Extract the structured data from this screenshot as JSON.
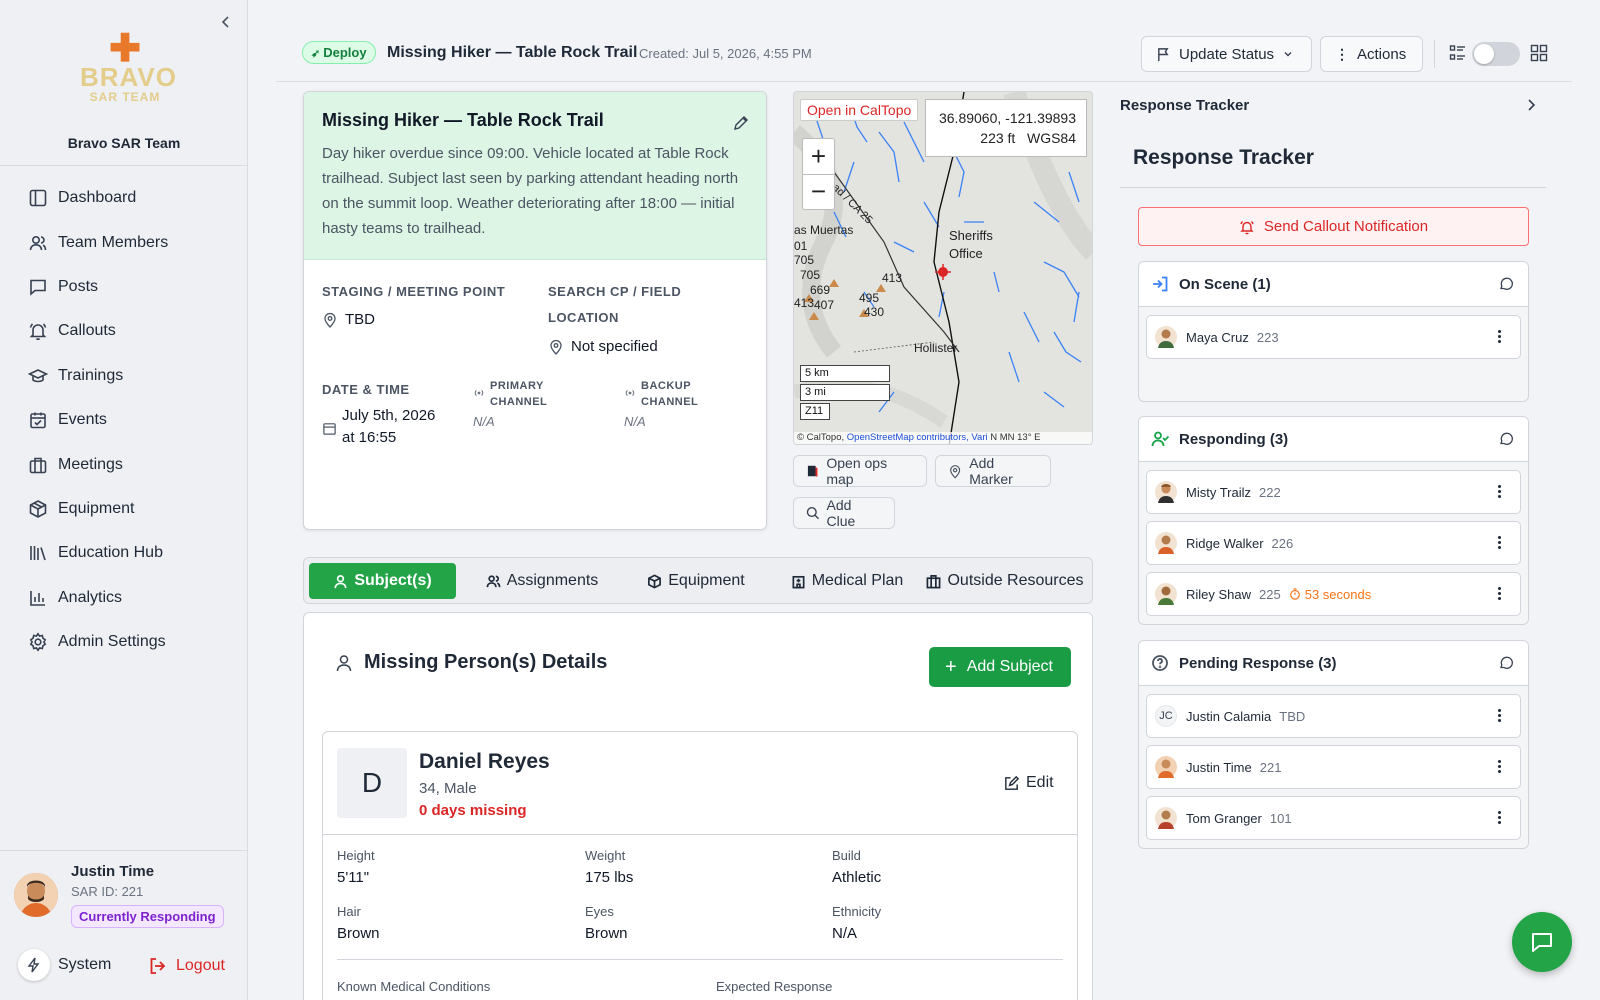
{
  "sidebar": {
    "logo": {
      "line1": "BRAVO",
      "line2": "SAR TEAM"
    },
    "team_name": "Bravo SAR Team",
    "nav": [
      {
        "label": "Dashboard",
        "icon": "dashboard-icon"
      },
      {
        "label": "Team Members",
        "icon": "users-icon"
      },
      {
        "label": "Posts",
        "icon": "message-square-icon"
      },
      {
        "label": "Callouts",
        "icon": "bell-icon"
      },
      {
        "label": "Trainings",
        "icon": "graduation-cap-icon"
      },
      {
        "label": "Events",
        "icon": "calendar-check-icon"
      },
      {
        "label": "Meetings",
        "icon": "building-icon"
      },
      {
        "label": "Equipment",
        "icon": "package-icon"
      },
      {
        "label": "Education Hub",
        "icon": "library-icon"
      },
      {
        "label": "Analytics",
        "icon": "bar-chart-icon"
      },
      {
        "label": "Admin Settings",
        "icon": "gear-icon"
      }
    ],
    "user": {
      "name": "Justin Time",
      "sar_id": "SAR ID: 221",
      "status_badge": "Currently Responding"
    },
    "system_label": "System",
    "logout_label": "Logout"
  },
  "topbar": {
    "badge": "Deploy",
    "title": "Missing Hiker — Table Rock Trail",
    "created": "Created: Jul 5, 2026, 4:55 PM",
    "update_status_label": "Update Status",
    "actions_label": "Actions"
  },
  "incident": {
    "title": "Missing Hiker — Table Rock Trail",
    "description": "Day hiker overdue since 09:00. Vehicle located at Table Rock trailhead. Subject last seen by parking attendant heading north on the summit loop. Weather deteriorating after 18:00 — initial hasty teams to trailhead.",
    "staging_label": "STAGING / MEETING POINT",
    "staging_value": "TBD",
    "search_cp_label_1": "SEARCH CP / FIELD",
    "search_cp_label_2": "LOCATION",
    "search_cp_value": "Not specified",
    "date_time_label": "DATE & TIME",
    "date_value_1": "July 5th, 2026",
    "date_value_2": "at 16:55",
    "primary_channel_label_1": "PRIMARY",
    "primary_channel_label_2": "CHANNEL",
    "primary_channel_value": "N/A",
    "backup_channel_label_1": "BACKUP",
    "backup_channel_label_2": "CHANNEL",
    "backup_channel_value": "N/A"
  },
  "map": {
    "open_caltopo_label": "Open in CalTopo",
    "coords": "36.89060, -121.39893",
    "elevation": "223 ft",
    "datum": "WGS84",
    "zoom_in": "+",
    "zoom_out": "−",
    "place_labels": [
      "as Muertas",
      "Sheriffs",
      "Office",
      "Hollister",
      "ad / CA 25"
    ],
    "elevation_labels": [
      "01",
      "705",
      "705",
      "669",
      "413",
      "407",
      "495",
      "430",
      "413"
    ],
    "scale_km": "5 km",
    "scale_mi": "3 mi",
    "zone": "Z11",
    "attribution_prefix": "© CalTopo, ",
    "attribution_link": "OpenStreetMap contributors, Vari",
    "attribution_suffix": " N MN 13° E",
    "open_ops_map_label": "Open ops map",
    "add_marker_label": "Add Marker",
    "add_clue_label": "Add Clue"
  },
  "tabs": [
    {
      "label": "Subject(s)",
      "active": true
    },
    {
      "label": "Assignments",
      "active": false
    },
    {
      "label": "Equipment",
      "active": false
    },
    {
      "label": "Medical Plan",
      "active": false
    },
    {
      "label": "Outside Resources",
      "active": false
    }
  ],
  "subject_panel": {
    "title": "Missing Person(s) Details",
    "add_subject_label": "Add Subject",
    "subject": {
      "initial": "D",
      "name": "Daniel Reyes",
      "age_sex": "34, Male",
      "days_missing": "0 days missing",
      "edit_label": "Edit",
      "attributes": [
        {
          "label": "Height",
          "value": "5'11\""
        },
        {
          "label": "Weight",
          "value": "175 lbs"
        },
        {
          "label": "Build",
          "value": "Athletic"
        },
        {
          "label": "Hair",
          "value": "Brown"
        },
        {
          "label": "Eyes",
          "value": "Brown"
        },
        {
          "label": "Ethnicity",
          "value": "N/A"
        }
      ],
      "medical_label": "Known Medical Conditions",
      "expected_response_label": "Expected Response"
    }
  },
  "response_tracker": {
    "header": "Response Tracker",
    "title": "Response Tracker",
    "callout_label": "Send Callout Notification",
    "groups": {
      "on_scene": {
        "title": "On Scene (1)",
        "members": [
          {
            "name": "Maya Cruz",
            "number": "223"
          }
        ]
      },
      "responding": {
        "title": "Responding (3)",
        "members": [
          {
            "name": "Misty Trailz",
            "number": "222"
          },
          {
            "name": "Ridge Walker",
            "number": "226"
          },
          {
            "name": "Riley Shaw",
            "number": "225",
            "eta": "53 seconds"
          }
        ]
      },
      "pending": {
        "title": "Pending Response (3)",
        "members": [
          {
            "name": "Justin Calamia",
            "number": "TBD",
            "initials": "JC"
          },
          {
            "name": "Justin Time",
            "number": "221"
          },
          {
            "name": "Tom Granger",
            "number": "101"
          }
        ]
      }
    }
  },
  "colors": {
    "accent_green": "#22a447",
    "danger_red": "#dc2626",
    "badge_purple": "#7e22ce",
    "eta_orange": "#f97316"
  }
}
